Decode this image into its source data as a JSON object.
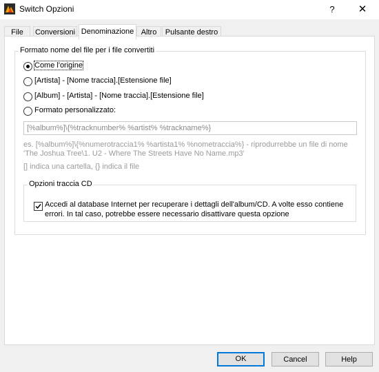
{
  "window": {
    "title": "Switch Opzioni",
    "help_glyph": "?",
    "close_glyph": "✕"
  },
  "tabs": [
    {
      "label": "File"
    },
    {
      "label": "Conversioni"
    },
    {
      "label": "Denominazione",
      "active": true
    },
    {
      "label": "Altro"
    },
    {
      "label": "Pulsante destro"
    }
  ],
  "naming_group": {
    "title": "Formato nome del file per i file convertiti",
    "options": [
      {
        "label": "Come l'origine",
        "selected": true
      },
      {
        "label": "[Artista] - [Nome traccia].[Estensione file]",
        "selected": false
      },
      {
        "label": "[Album] - [Artista] - [Nome traccia].[Estensione file]",
        "selected": false
      },
      {
        "label": "Formato personalizzato:",
        "selected": false
      }
    ],
    "custom_format_value": "[%album%]\\{%tracknumber% %artist% %trackname%}",
    "example_line1": "es. [%album%]\\{%numerotraccia1% %artista1% %nometraccia%} - riprodurrebbe un file di nome",
    "example_line2": "'The Joshua Tree\\1. U2 - Where The Streets Have No Name.mp3'",
    "legend": "[] indica una cartella, {} indica il file"
  },
  "cd_group": {
    "title": "Opzioni traccia CD",
    "checkbox_checked": true,
    "checkbox_label": "Accedi al database Internet per recuperare i dettagli dell'album/CD. A volte esso contiene errori. In tal caso, potrebbe essere necessario disattivare questa opzione"
  },
  "buttons": {
    "ok": "OK",
    "cancel": "Cancel",
    "help": "Help"
  },
  "colors": {
    "accent": "#0078d7",
    "dialog_bg": "#f0f0f0"
  }
}
